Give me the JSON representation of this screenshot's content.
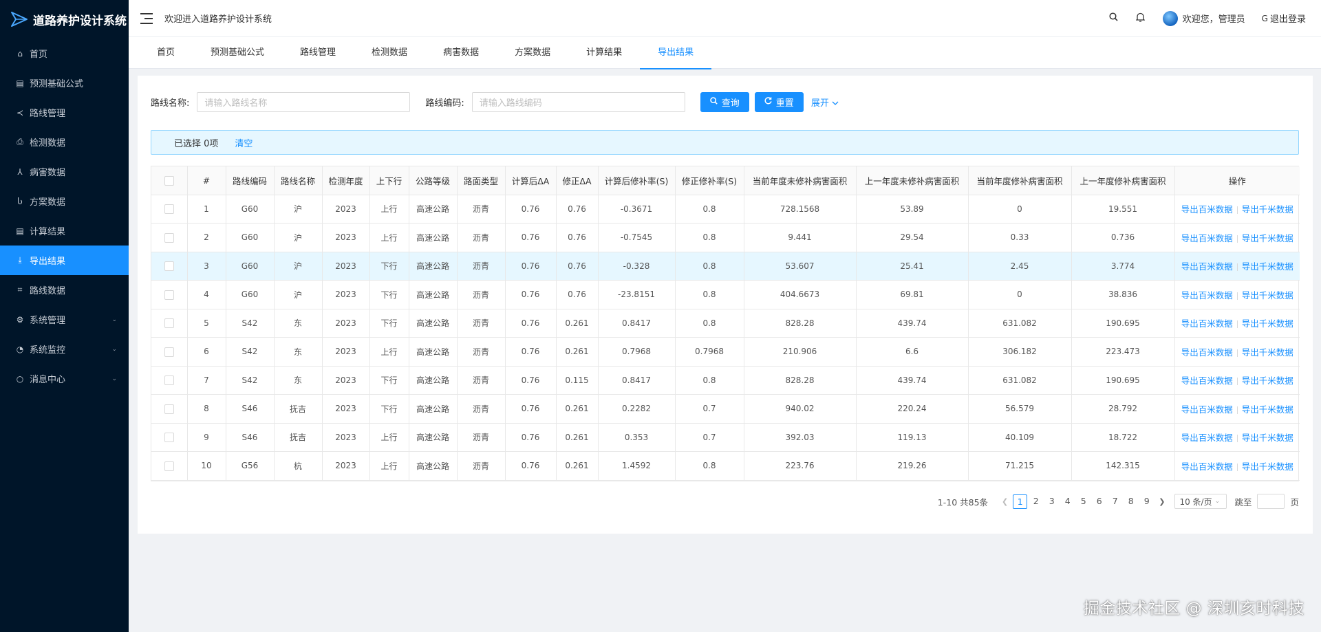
{
  "app": {
    "title": "道路养护设计系统",
    "welcome": "欢迎进入道路养护设计系统"
  },
  "colors": {
    "sidebar_bg": "#001529",
    "accent": "#1890ff",
    "highlight_row": "#e6f7ff"
  },
  "sidebar": {
    "items": [
      {
        "label": "首页",
        "icon": "home-icon"
      },
      {
        "label": "预测基础公式",
        "icon": "table-icon"
      },
      {
        "label": "路线管理",
        "icon": "share-icon"
      },
      {
        "label": "检测数据",
        "icon": "printer-icon"
      },
      {
        "label": "病害数据",
        "icon": "nodes-icon"
      },
      {
        "label": "方案数据",
        "icon": "flask-icon"
      },
      {
        "label": "计算结果",
        "icon": "table-icon"
      },
      {
        "label": "导出结果",
        "icon": "download-icon",
        "active": true
      },
      {
        "label": "路线数据",
        "icon": "route-icon"
      },
      {
        "label": "系统管理",
        "icon": "gear-icon",
        "expandable": true
      },
      {
        "label": "系统监控",
        "icon": "gauge-icon",
        "expandable": true
      },
      {
        "label": "消息中心",
        "icon": "message-icon",
        "expandable": true
      }
    ]
  },
  "header": {
    "user_label": "欢迎您，管理员",
    "logout_label": "退出登录"
  },
  "tabs": [
    {
      "label": "首页"
    },
    {
      "label": "预测基础公式"
    },
    {
      "label": "路线管理"
    },
    {
      "label": "检测数据"
    },
    {
      "label": "病害数据"
    },
    {
      "label": "方案数据"
    },
    {
      "label": "计算结果"
    },
    {
      "label": "导出结果",
      "active": true
    }
  ],
  "search": {
    "route_name_label": "路线名称:",
    "route_name_placeholder": "请输入路线名称",
    "route_code_label": "路线编码:",
    "route_code_placeholder": "请输入路线编码",
    "query_label": "查询",
    "reset_label": "重置",
    "expand_label": "展开"
  },
  "selection": {
    "text": "已选择 0项",
    "clear_label": "清空"
  },
  "table": {
    "columns": [
      "#",
      "路线编码",
      "路线名称",
      "检测年度",
      "上下行",
      "公路等级",
      "路面类型",
      "计算后ΔA",
      "修正ΔA",
      "计算后修补率(S)",
      "修正修补率(S)",
      "当前年度未修补病害面积",
      "上一年度未修补病害面积",
      "当前年度修补病害面积",
      "上一年度修补病害面积",
      "操作"
    ],
    "action_100m": "导出百米数据",
    "action_1km": "导出千米数据",
    "rows": [
      [
        "1",
        "G60",
        "沪",
        "2023",
        "上行",
        "高速公路",
        "沥青",
        "0.76",
        "0.76",
        "-0.3671",
        "0.8",
        "728.1568",
        "53.89",
        "0",
        "19.551"
      ],
      [
        "2",
        "G60",
        "沪",
        "2023",
        "上行",
        "高速公路",
        "沥青",
        "0.76",
        "0.76",
        "-0.7545",
        "0.8",
        "9.441",
        "29.54",
        "0.33",
        "0.736"
      ],
      [
        "3",
        "G60",
        "沪",
        "2023",
        "下行",
        "高速公路",
        "沥青",
        "0.76",
        "0.76",
        "-0.328",
        "0.8",
        "53.607",
        "25.41",
        "2.45",
        "3.774"
      ],
      [
        "4",
        "G60",
        "沪",
        "2023",
        "下行",
        "高速公路",
        "沥青",
        "0.76",
        "0.76",
        "-23.8151",
        "0.8",
        "404.6673",
        "69.81",
        "0",
        "38.836"
      ],
      [
        "5",
        "S42",
        "东",
        "2023",
        "下行",
        "高速公路",
        "沥青",
        "0.76",
        "0.261",
        "0.8417",
        "0.8",
        "828.28",
        "439.74",
        "631.082",
        "190.695"
      ],
      [
        "6",
        "S42",
        "东",
        "2023",
        "上行",
        "高速公路",
        "沥青",
        "0.76",
        "0.261",
        "0.7968",
        "0.7968",
        "210.906",
        "6.6",
        "306.182",
        "223.473"
      ],
      [
        "7",
        "S42",
        "东",
        "2023",
        "下行",
        "高速公路",
        "沥青",
        "0.76",
        "0.115",
        "0.8417",
        "0.8",
        "828.28",
        "439.74",
        "631.082",
        "190.695"
      ],
      [
        "8",
        "S46",
        "抚吉",
        "2023",
        "下行",
        "高速公路",
        "沥青",
        "0.76",
        "0.261",
        "0.2282",
        "0.7",
        "940.02",
        "220.24",
        "56.579",
        "28.792"
      ],
      [
        "9",
        "S46",
        "抚吉",
        "2023",
        "上行",
        "高速公路",
        "沥青",
        "0.76",
        "0.261",
        "0.353",
        "0.7",
        "392.03",
        "119.13",
        "40.109",
        "18.722"
      ],
      [
        "10",
        "G56",
        "杭",
        "2023",
        "上行",
        "高速公路",
        "沥青",
        "0.76",
        "0.261",
        "1.4592",
        "0.8",
        "223.76",
        "219.26",
        "71.215",
        "142.315"
      ]
    ],
    "highlighted_row": 3
  },
  "pagination": {
    "total_text": "1-10 共85条",
    "pages": [
      "1",
      "2",
      "3",
      "4",
      "5",
      "6",
      "7",
      "8",
      "9"
    ],
    "current": "1",
    "page_size": "10 条/页",
    "jump_label": "跳至",
    "page_suffix": "页"
  },
  "watermark": "掘金技术社区 @ 深圳亥时科技"
}
